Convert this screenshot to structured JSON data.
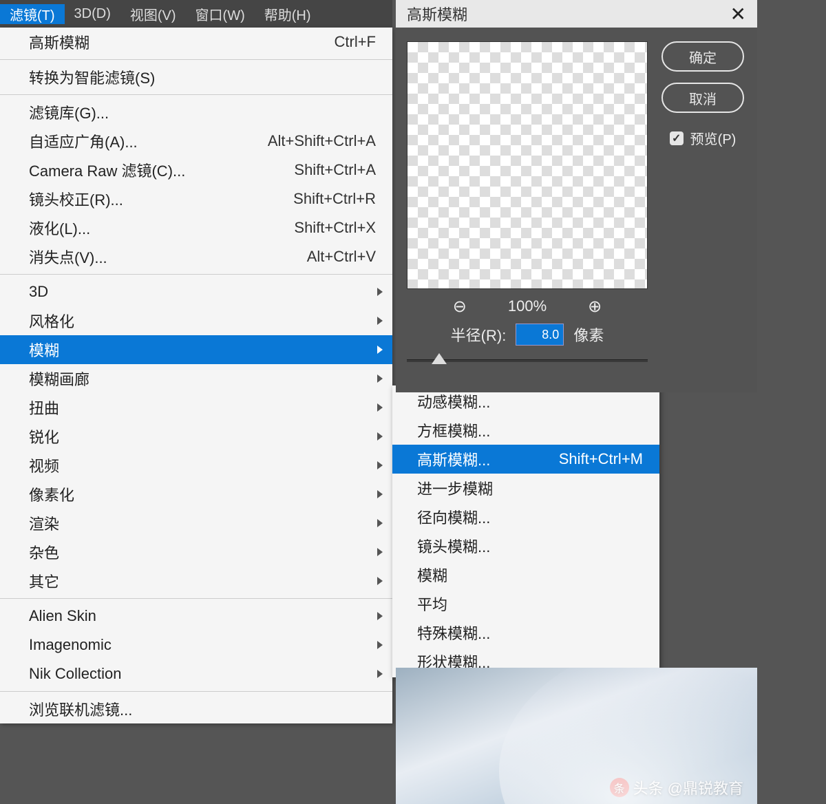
{
  "menubar": [
    {
      "label": "滤镜(T)",
      "active": true
    },
    {
      "label": "3D(D)"
    },
    {
      "label": "视图(V)"
    },
    {
      "label": "窗口(W)"
    },
    {
      "label": "帮助(H)"
    }
  ],
  "filter_menu": {
    "recent": {
      "label": "高斯模糊",
      "shortcut": "Ctrl+F"
    },
    "smart": {
      "label": "转换为智能滤镜(S)"
    },
    "group1": [
      {
        "label": "滤镜库(G)...",
        "shortcut": ""
      },
      {
        "label": "自适应广角(A)...",
        "shortcut": "Alt+Shift+Ctrl+A"
      },
      {
        "label": "Camera Raw 滤镜(C)...",
        "shortcut": "Shift+Ctrl+A"
      },
      {
        "label": "镜头校正(R)...",
        "shortcut": "Shift+Ctrl+R"
      },
      {
        "label": "液化(L)...",
        "shortcut": "Shift+Ctrl+X"
      },
      {
        "label": "消失点(V)...",
        "shortcut": "Alt+Ctrl+V"
      }
    ],
    "group2": [
      {
        "label": "3D"
      },
      {
        "label": "风格化"
      },
      {
        "label": "模糊",
        "highlight": true
      },
      {
        "label": "模糊画廊"
      },
      {
        "label": "扭曲"
      },
      {
        "label": "锐化"
      },
      {
        "label": "视频"
      },
      {
        "label": "像素化"
      },
      {
        "label": "渲染"
      },
      {
        "label": "杂色"
      },
      {
        "label": "其它"
      }
    ],
    "group3": [
      {
        "label": "Alien Skin"
      },
      {
        "label": "Imagenomic"
      },
      {
        "label": "Nik Collection"
      }
    ],
    "browse": {
      "label": "浏览联机滤镜..."
    }
  },
  "blur_submenu": [
    {
      "label": "动感模糊...",
      "shortcut": ""
    },
    {
      "label": "方框模糊...",
      "shortcut": ""
    },
    {
      "label": "高斯模糊...",
      "shortcut": "Shift+Ctrl+M",
      "highlight": true
    },
    {
      "label": "进一步模糊",
      "shortcut": ""
    },
    {
      "label": "径向模糊...",
      "shortcut": ""
    },
    {
      "label": "镜头模糊...",
      "shortcut": ""
    },
    {
      "label": "模糊",
      "shortcut": ""
    },
    {
      "label": "平均",
      "shortcut": ""
    },
    {
      "label": "特殊模糊...",
      "shortcut": ""
    },
    {
      "label": "形状模糊...",
      "shortcut": ""
    }
  ],
  "dialog": {
    "title": "高斯模糊",
    "ok": "确定",
    "cancel": "取消",
    "preview_label": "预览(P)",
    "preview_checked": true,
    "zoom": "100%",
    "radius_label": "半径(R):",
    "radius_value": "8.0",
    "radius_unit": "像素"
  },
  "watermark": {
    "prefix": "头条",
    "text": "@鼎锐教育"
  }
}
